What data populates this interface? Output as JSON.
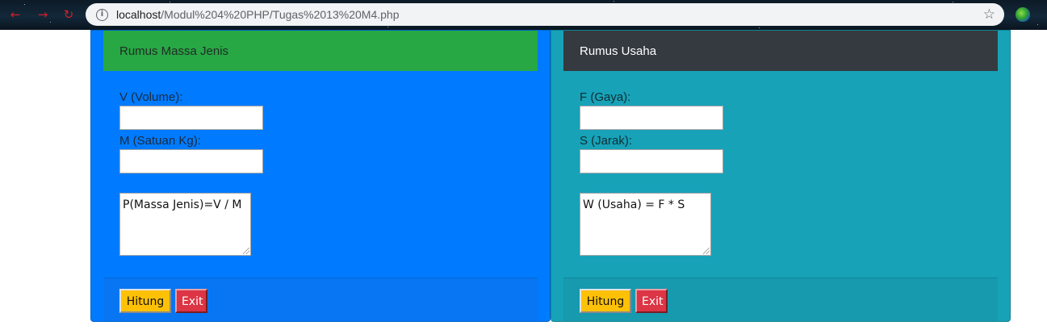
{
  "browser": {
    "url_host": "localhost",
    "url_path": "/Modul%204%20PHP/Tugas%2013%20M4.php",
    "info_icon": "info-icon",
    "bookmark_icon": "star-icon"
  },
  "colors": {
    "primary": "#007bff",
    "info": "#17a2b8",
    "success": "#28a745",
    "dark": "#343a40",
    "warning": "#ffc107",
    "danger": "#dc3545"
  },
  "massa_jenis": {
    "title": "Rumus Massa Jenis",
    "volume_label": "V (Volume):",
    "volume_value": "",
    "mass_label": "M (Satuan Kg):",
    "mass_value": "",
    "result_text": "P(Massa Jenis)=V / M",
    "hitung_label": "Hitung",
    "exit_label": "Exit"
  },
  "usaha": {
    "title": "Rumus Usaha",
    "force_label": "F (Gaya):",
    "force_value": "",
    "distance_label": "S (Jarak):",
    "distance_value": "",
    "result_text": "W (Usaha) = F * S",
    "hitung_label": "Hitung",
    "exit_label": "Exit"
  }
}
